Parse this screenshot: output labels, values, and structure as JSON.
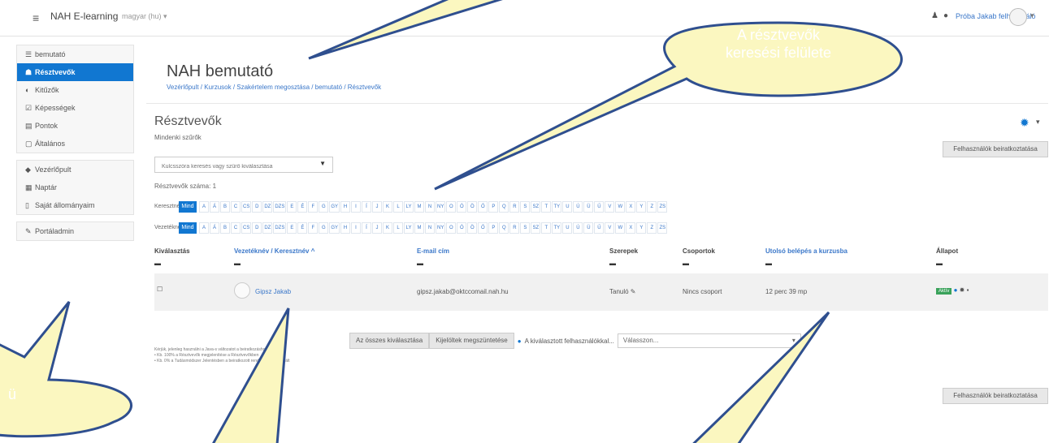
{
  "topbar": {
    "brand": "NAH E-learning",
    "language": "magyar (hu) ▾",
    "user": "Próba Jakab felhasználó"
  },
  "sidebar": {
    "group1": [
      {
        "label": "bemutató",
        "icon": "graduation-cap-icon",
        "glyph": "☰",
        "active": false
      },
      {
        "label": "Résztvevők",
        "icon": "users-icon",
        "glyph": "☗",
        "active": true
      },
      {
        "label": "Kitűzők",
        "icon": "badge-icon",
        "glyph": "◐",
        "active": false
      },
      {
        "label": "Képességek",
        "icon": "check-list-icon",
        "glyph": "☑",
        "active": false
      },
      {
        "label": "Pontok",
        "icon": "grades-icon",
        "glyph": "▤",
        "active": false
      },
      {
        "label": "Általános",
        "icon": "folder-icon",
        "glyph": "▢",
        "active": false
      }
    ],
    "group2": [
      {
        "label": "Vezérlőpult",
        "icon": "dashboard-icon",
        "glyph": "◆"
      },
      {
        "label": "Naptár",
        "icon": "calendar-icon",
        "glyph": "▦"
      },
      {
        "label": "Saját állományaim",
        "icon": "file-icon",
        "glyph": "▯"
      }
    ],
    "group3": [
      {
        "label": "Portáladmin",
        "icon": "wrench-icon",
        "glyph": "✎"
      }
    ]
  },
  "main": {
    "page_title": "NAH bemutató",
    "breadcrumb": "Vezérlőpult / Kurzusok / Szakértelem megosztása / bemutató / Résztvevők",
    "section_title": "Résztvevők",
    "filter_link": "Mindenki szűrők",
    "enrol_button": "Felhasználók beiratkoztatása",
    "search_placeholder": "Kulcsszóra keresés vagy szűrő kiválasztása",
    "participant_count": "Résztvevők száma: 1",
    "firstname_label": "Keresztnév",
    "lastname_label": "Vezetéknév",
    "all_label": "Mind",
    "letters": [
      "A",
      "Á",
      "B",
      "C",
      "CS",
      "D",
      "DZ",
      "DZS",
      "E",
      "É",
      "F",
      "G",
      "GY",
      "H",
      "I",
      "Í",
      "J",
      "K",
      "L",
      "LY",
      "M",
      "N",
      "NY",
      "O",
      "Ó",
      "Ö",
      "Ő",
      "P",
      "Q",
      "R",
      "S",
      "SZ",
      "T",
      "TY",
      "U",
      "Ú",
      "Ü",
      "Ű",
      "V",
      "W",
      "X",
      "Y",
      "Z",
      "ZS"
    ],
    "table": {
      "headers": [
        "Kiválasztás",
        "Vezetéknév / Keresztnév ^",
        "E-mail cím",
        "Szerepek",
        "Csoportok",
        "Utolsó belépés a kurzusba",
        "Állapot"
      ],
      "row": {
        "name": "Gipsz Jakab",
        "email": "gipsz.jakab@oktccomail.nah.hu",
        "role": "Tanuló ✎",
        "group": "Nincs csoport",
        "last_access": "12 perc 39 mp",
        "status": "Aktív",
        "status_color": "#3aa25b"
      }
    },
    "select_all_button": "Az összes kiválasztása",
    "deselect_button": "Kijelöltek megszüntetése",
    "with_selected": "A kiválasztott felhasználókkal...",
    "with_selected_value": "Válasszon...",
    "notes": [
      "Kérjük, jelenleg használni a Java-s változatot a beiratkozáshoz... 100 1",
      "• Kb. 100% a Résztvevők megjelenítése a Résztvevőkben",
      "• Kb. 0% a Tudásmódszer Jelentésben a beiratkozott rendszerben használt"
    ],
    "enrol_button_bottom": "Felhasználók beiratkoztatása"
  },
  "callouts": {
    "search": "A résztvevők keresési felülete",
    "corner": "ü",
    "fill": "#fbf7c0",
    "stroke": "#2f4f8f"
  }
}
